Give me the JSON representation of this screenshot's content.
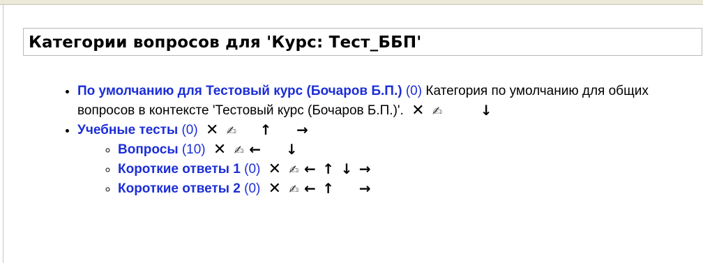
{
  "heading": "Категории вопросов для 'Курс: Тест_ББП'",
  "categories": [
    {
      "name": "По умолчанию для Тестовый курс (Бочаров Б.П.)",
      "count": "(0)",
      "description": "Категория по умолчанию для общих вопросов в контексте 'Тестовый курс (Бочаров Б.П.)'."
    },
    {
      "name": "Учебные тесты",
      "count": "(0)",
      "children": [
        {
          "name": "Вопросы",
          "count": "(10)"
        },
        {
          "name": "Короткие ответы 1",
          "count": "(0)"
        },
        {
          "name": "Короткие ответы 2",
          "count": "(0)"
        }
      ]
    }
  ],
  "icons": {
    "delete": "✕",
    "edit": "✍",
    "left": "←",
    "up": "↑",
    "down": "↓",
    "right": "→"
  },
  "colors": {
    "link": "#1c2ed6",
    "border": "#b8b8b8"
  }
}
